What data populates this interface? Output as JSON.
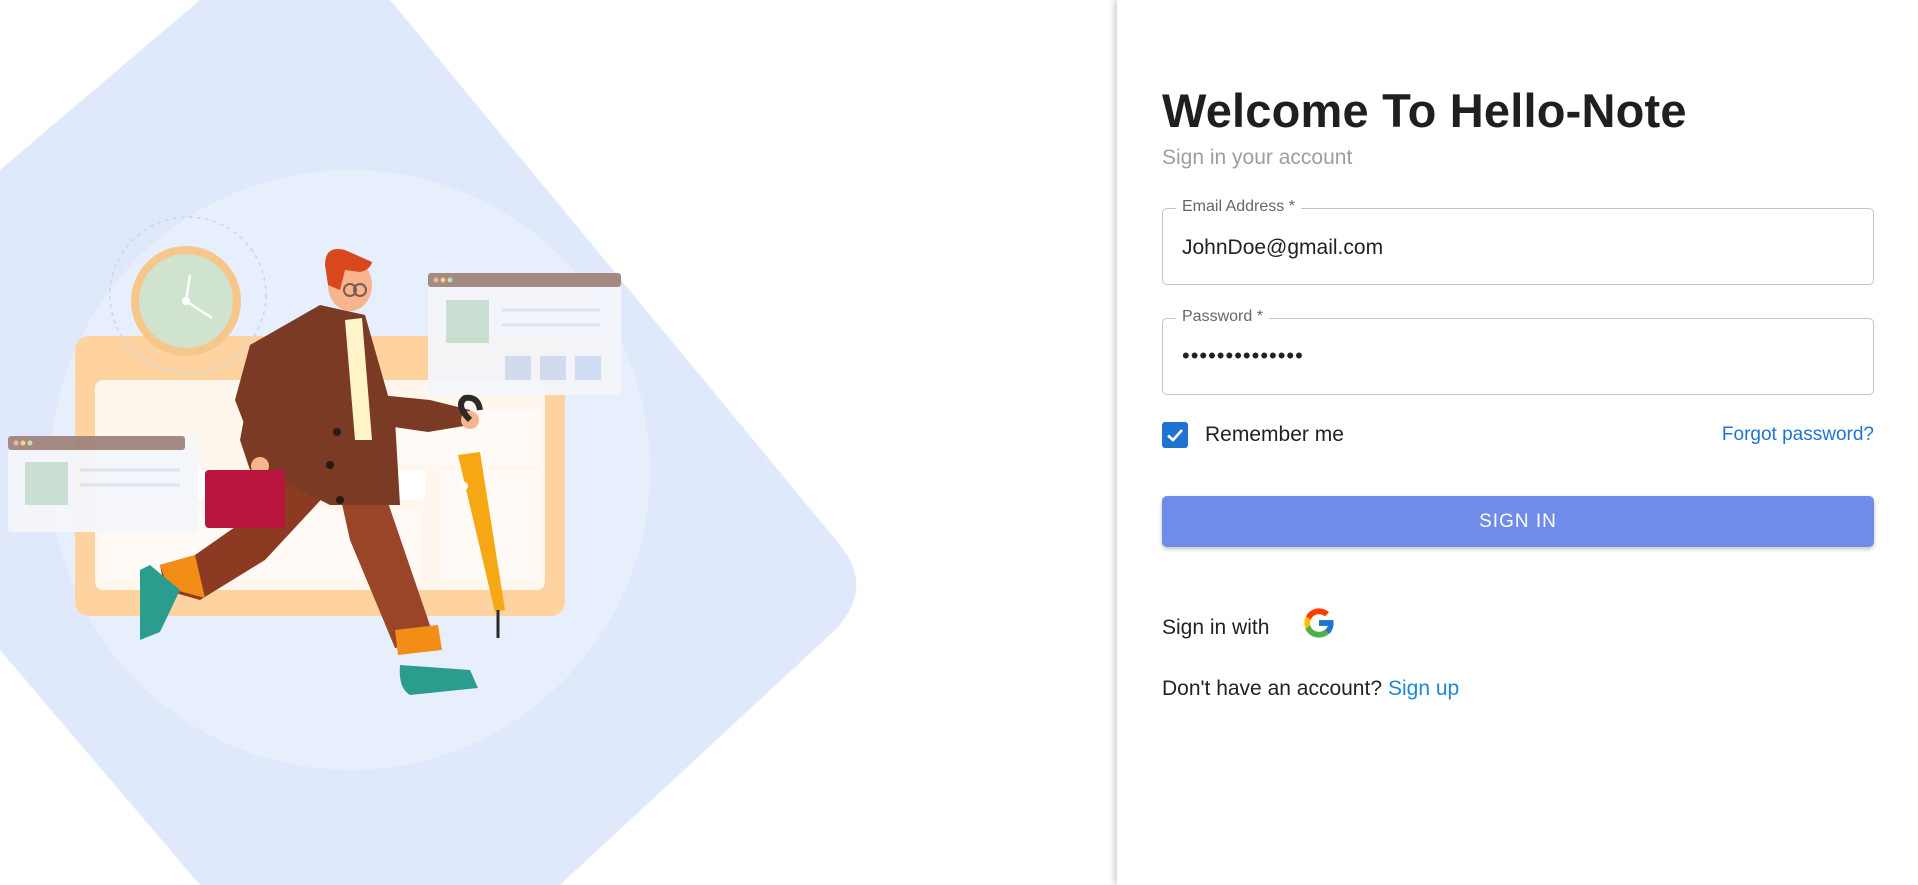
{
  "app": {
    "title": "Welcome To Hello-Note",
    "subtitle": "Sign in your account"
  },
  "form": {
    "email": {
      "label": "Email Address *",
      "value": "JohnDoe@gmail.com"
    },
    "password": {
      "label": "Password *",
      "value": "••••••••••••••"
    },
    "remember": {
      "label": "Remember me",
      "checked": true
    },
    "forgot_label": "Forgot password?",
    "submit_label": "SIGN IN",
    "social_label": "Sign in with",
    "signup_prompt": "Don't have an account?",
    "signup_link": "Sign up"
  },
  "illustration": {
    "icons": [
      "clock-icon",
      "google-icon",
      "check-icon"
    ]
  },
  "colors": {
    "primary_button": "#6f8de8",
    "link": "#1e74d0",
    "checkbox": "#1e74d0",
    "illustration_bg": "#e0e9fb"
  }
}
